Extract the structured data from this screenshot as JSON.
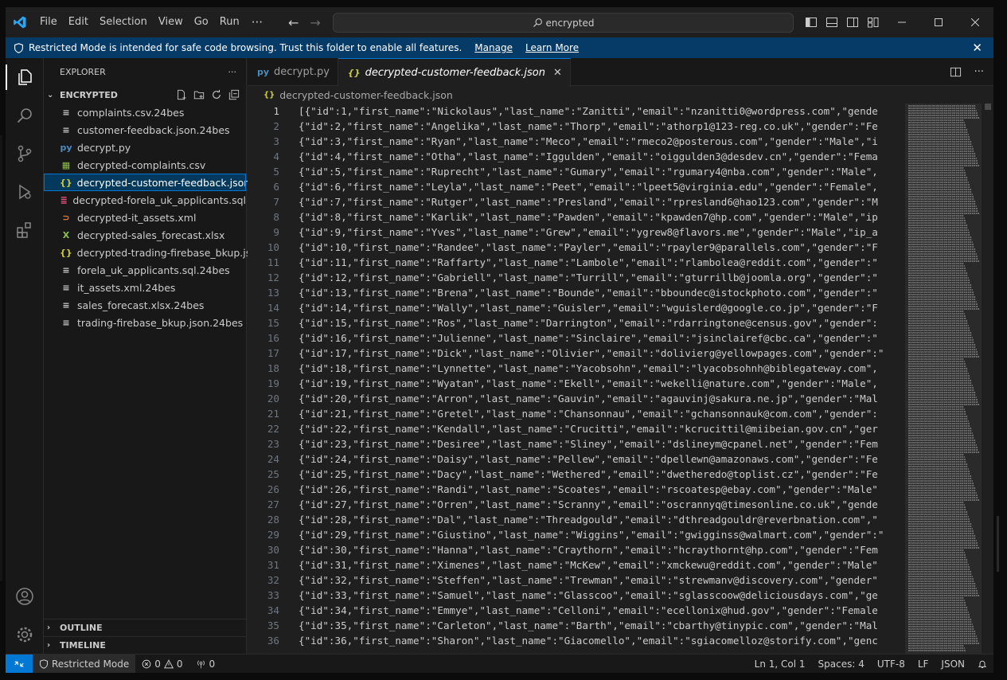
{
  "titlebar": {
    "menu": [
      "File",
      "Edit",
      "Selection",
      "View",
      "Go",
      "Run"
    ],
    "more": "···",
    "search_text": "encrypted"
  },
  "banner": {
    "text": "Restricted Mode is intended for safe code browsing. Trust this folder to enable all features.",
    "manage": "Manage",
    "learn_more": "Learn More"
  },
  "sidebar": {
    "title": "EXPLORER",
    "more": "···",
    "folder": "ENCRYPTED",
    "files": [
      {
        "name": "complaints.csv.24bes",
        "icon": "≡",
        "color": "#cccccc"
      },
      {
        "name": "customer-feedback.json.24bes",
        "icon": "≡",
        "color": "#cccccc"
      },
      {
        "name": "decrypt.py",
        "icon": "py",
        "color": "#4b8bbe"
      },
      {
        "name": "decrypted-complaints.csv",
        "icon": "▦",
        "color": "#8dc149"
      },
      {
        "name": "decrypted-customer-feedback.json",
        "icon": "{}",
        "color": "#cbcb41"
      },
      {
        "name": "decrypted-forela_uk_applicants.sql",
        "icon": "≣",
        "color": "#f55385"
      },
      {
        "name": "decrypted-it_assets.xml",
        "icon": "⊃",
        "color": "#e37933"
      },
      {
        "name": "decrypted-sales_forecast.xlsx",
        "icon": "X",
        "color": "#8dc149"
      },
      {
        "name": "decrypted-trading-firebase_bkup.json",
        "icon": "{}",
        "color": "#cbcb41"
      },
      {
        "name": "forela_uk_applicants.sql.24bes",
        "icon": "≡",
        "color": "#cccccc"
      },
      {
        "name": "it_assets.xml.24bes",
        "icon": "≡",
        "color": "#cccccc"
      },
      {
        "name": "sales_forecast.xlsx.24bes",
        "icon": "≡",
        "color": "#cccccc"
      },
      {
        "name": "trading-firebase_bkup.json.24bes",
        "icon": "≡",
        "color": "#cccccc"
      }
    ],
    "outline": "OUTLINE",
    "timeline": "TIMELINE"
  },
  "editor": {
    "tabs": [
      {
        "name": "decrypt.py",
        "icon": "py",
        "color": "#4b8bbe",
        "active": false
      },
      {
        "name": "decrypted-customer-feedback.json",
        "icon": "{}",
        "color": "#cbcb41",
        "active": true
      }
    ],
    "breadcrumb": "decrypted-customer-feedback.json",
    "lines": [
      "[{\"id\":1,\"first_name\":\"Nickolaus\",\"last_name\":\"Zanitti\",\"email\":\"nzanitti0@wordpress.com\",\"gende",
      "{\"id\":2,\"first_name\":\"Angelika\",\"last_name\":\"Thorp\",\"email\":\"athorp1@123-reg.co.uk\",\"gender\":\"Fe",
      "{\"id\":3,\"first_name\":\"Ryan\",\"last_name\":\"Meco\",\"email\":\"rmeco2@posterous.com\",\"gender\":\"Male\",\"i",
      "{\"id\":4,\"first_name\":\"Otha\",\"last_name\":\"Iggulden\",\"email\":\"oiggulden3@desdev.cn\",\"gender\":\"Fema",
      "{\"id\":5,\"first_name\":\"Ruprecht\",\"last_name\":\"Gumary\",\"email\":\"rgumary4@nba.com\",\"gender\":\"Male\",",
      "{\"id\":6,\"first_name\":\"Leyla\",\"last_name\":\"Peet\",\"email\":\"lpeet5@virginia.edu\",\"gender\":\"Female\",",
      "{\"id\":7,\"first_name\":\"Rutger\",\"last_name\":\"Presland\",\"email\":\"rpresland6@hao123.com\",\"gender\":\"M",
      "{\"id\":8,\"first_name\":\"Karlik\",\"last_name\":\"Pawden\",\"email\":\"kpawden7@hp.com\",\"gender\":\"Male\",\"ip",
      "{\"id\":9,\"first_name\":\"Yves\",\"last_name\":\"Grew\",\"email\":\"ygrew8@flavors.me\",\"gender\":\"Male\",\"ip_a",
      "{\"id\":10,\"first_name\":\"Randee\",\"last_name\":\"Payler\",\"email\":\"rpayler9@parallels.com\",\"gender\":\"F",
      "{\"id\":11,\"first_name\":\"Raffarty\",\"last_name\":\"Lambole\",\"email\":\"rlambolea@reddit.com\",\"gender\":\"",
      "{\"id\":12,\"first_name\":\"Gabriell\",\"last_name\":\"Turrill\",\"email\":\"gturrillb@joomla.org\",\"gender\":\"",
      "{\"id\":13,\"first_name\":\"Brena\",\"last_name\":\"Bounde\",\"email\":\"bboundec@istockphoto.com\",\"gender\":\"",
      "{\"id\":14,\"first_name\":\"Wally\",\"last_name\":\"Guisler\",\"email\":\"wguislerd@google.co.jp\",\"gender\":\"F",
      "{\"id\":15,\"first_name\":\"Ros\",\"last_name\":\"Darrington\",\"email\":\"rdarringtone@census.gov\",\"gender\":",
      "{\"id\":16,\"first_name\":\"Julienne\",\"last_name\":\"Sinclaire\",\"email\":\"jsinclairef@cbc.ca\",\"gender\":\"",
      "{\"id\":17,\"first_name\":\"Dick\",\"last_name\":\"Olivier\",\"email\":\"dolivierg@yellowpages.com\",\"gender\":\"",
      "{\"id\":18,\"first_name\":\"Lynnette\",\"last_name\":\"Yacobsohn\",\"email\":\"lyacobsohnh@biblegateway.com\",",
      "{\"id\":19,\"first_name\":\"Wyatan\",\"last_name\":\"Ekell\",\"email\":\"wekelli@nature.com\",\"gender\":\"Male\",",
      "{\"id\":20,\"first_name\":\"Arron\",\"last_name\":\"Gauvin\",\"email\":\"agauvinj@sakura.ne.jp\",\"gender\":\"Mal",
      "{\"id\":21,\"first_name\":\"Gretel\",\"last_name\":\"Chansonnau\",\"email\":\"gchansonnauk@com.com\",\"gender\":",
      "{\"id\":22,\"first_name\":\"Kendall\",\"last_name\":\"Crucitti\",\"email\":\"kcrucittil@miibeian.gov.cn\",\"ger",
      "{\"id\":23,\"first_name\":\"Desiree\",\"last_name\":\"Sliney\",\"email\":\"dslineym@cpanel.net\",\"gender\":\"Fem",
      "{\"id\":24,\"first_name\":\"Daisy\",\"last_name\":\"Pellew\",\"email\":\"dpellewn@amazonaws.com\",\"gender\":\"Fe",
      "{\"id\":25,\"first_name\":\"Dacy\",\"last_name\":\"Wethered\",\"email\":\"dwetheredo@toplist.cz\",\"gender\":\"Fe",
      "{\"id\":26,\"first_name\":\"Randi\",\"last_name\":\"Scoates\",\"email\":\"rscoatesp@ebay.com\",\"gender\":\"Male\"",
      "{\"id\":27,\"first_name\":\"Orren\",\"last_name\":\"Scranny\",\"email\":\"oscrannyq@timesonline.co.uk\",\"gende",
      "{\"id\":28,\"first_name\":\"Dal\",\"last_name\":\"Threadgould\",\"email\":\"dthreadgouldr@reverbnation.com\",\"",
      "{\"id\":29,\"first_name\":\"Giustino\",\"last_name\":\"Wiggins\",\"email\":\"gwigginss@walmart.com\",\"gender\":\"",
      "{\"id\":30,\"first_name\":\"Hanna\",\"last_name\":\"Craythorn\",\"email\":\"hcraythornt@hp.com\",\"gender\":\"Fem",
      "{\"id\":31,\"first_name\":\"Ximenes\",\"last_name\":\"McKew\",\"email\":\"xmckewu@reddit.com\",\"gender\":\"Male\"",
      "{\"id\":32,\"first_name\":\"Steffen\",\"last_name\":\"Trewman\",\"email\":\"strewmanv@discovery.com\",\"gender\"",
      "{\"id\":33,\"first_name\":\"Samuel\",\"last_name\":\"Glasscoo\",\"email\":\"sglasscoow@deliciousdays.com\",\"ge",
      "{\"id\":34,\"first_name\":\"Emmye\",\"last_name\":\"Celloni\",\"email\":\"ecellonix@hud.gov\",\"gender\":\"Female",
      "{\"id\":35,\"first_name\":\"Carleton\",\"last_name\":\"Barth\",\"email\":\"cbarthy@tinypic.com\",\"gender\":\"Mal",
      "{\"id\":36,\"first_name\":\"Sharon\",\"last_name\":\"Giacomello\",\"email\":\"sgiacomelloz@storify.com\",\"genc"
    ]
  },
  "statusbar": {
    "restricted": "Restricted Mode",
    "errors": "0",
    "warnings": "0",
    "ports": "0",
    "position": "Ln 1, Col 1",
    "spaces": "Spaces: 4",
    "encoding": "UTF-8",
    "eol": "LF",
    "language": "JSON"
  },
  "colors": {
    "accent": "#0078d4",
    "banner": "#063b68",
    "json_icon": "#cbcb41"
  }
}
